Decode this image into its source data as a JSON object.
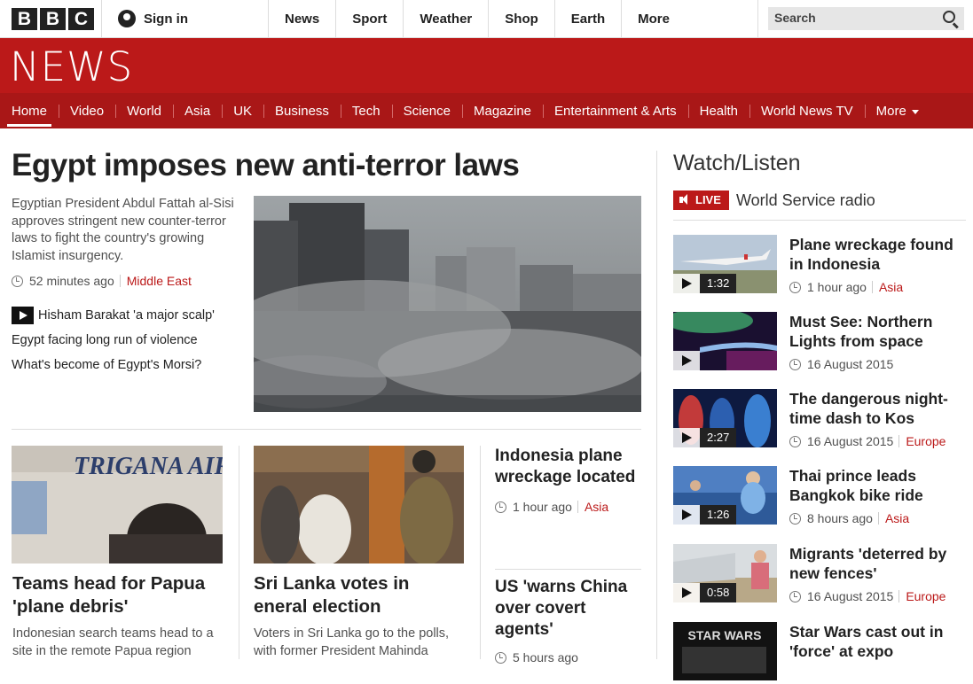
{
  "topbar": {
    "logo_letters": [
      "B",
      "B",
      "C"
    ],
    "signin": "Sign in",
    "nav": [
      "News",
      "Sport",
      "Weather",
      "Shop",
      "Earth",
      "More"
    ],
    "search_placeholder": "Search"
  },
  "brand": {
    "wordmark": "NEWS",
    "color": "#bb1919"
  },
  "subnav": {
    "items": [
      "Home",
      "Video",
      "World",
      "Asia",
      "UK",
      "Business",
      "Tech",
      "Science",
      "Magazine",
      "Entertainment & Arts",
      "Health",
      "World News TV"
    ],
    "more": "More",
    "active": "Home"
  },
  "lead": {
    "headline": "Egypt imposes new anti-terror laws",
    "summary": "Egyptian President Abdul Fattah al-Sisi approves stringent new counter-terror laws to fight the country's growing Islamist insurgency.",
    "time": "52 minutes ago",
    "region": "Middle East",
    "related": [
      {
        "text": "Hisham Barakat 'a major scalp'",
        "video": true
      },
      {
        "text": "Egypt facing long run of violence",
        "video": false
      },
      {
        "text": "What's become of Egypt's Morsi?",
        "video": false
      }
    ]
  },
  "cards": [
    {
      "title": "Teams head for Papua 'plane debris'",
      "summary": "Indonesian search teams head to a site in the remote Papua region",
      "image_text": "TRIGANA AIR"
    },
    {
      "title": "Sri Lanka votes in eneral election",
      "summary": "Voters in Sri Lanka go to the polls, with former President Mahinda"
    },
    {
      "title": "Indonesia plane wreckage located",
      "time": "1 hour ago",
      "region": "Asia"
    },
    {
      "title": "US 'warns China over covert agents'",
      "time": "5 hours ago"
    }
  ],
  "watch": {
    "title": "Watch/Listen",
    "live_label": "LIVE",
    "live_text": "World Service radio",
    "items": [
      {
        "title": "Plane wreckage found in Indonesia",
        "duration": "1:32",
        "time": "1 hour ago",
        "region": "Asia"
      },
      {
        "title": "Must See: Northern Lights from space",
        "duration": "",
        "time": "16 August 2015",
        "region": ""
      },
      {
        "title": "The dangerous night-time dash to Kos",
        "duration": "2:27",
        "time": "16 August 2015",
        "region": "Europe"
      },
      {
        "title": "Thai prince leads Bangkok bike ride",
        "duration": "1:26",
        "time": "8 hours ago",
        "region": "Asia"
      },
      {
        "title": "Migrants 'deterred by new fences'",
        "duration": "0:58",
        "time": "16 August 2015",
        "region": "Europe"
      },
      {
        "title": "Star Wars cast out in 'force' at expo",
        "duration": "",
        "time": "",
        "region": "",
        "image_text": "STAR WARS"
      }
    ]
  }
}
